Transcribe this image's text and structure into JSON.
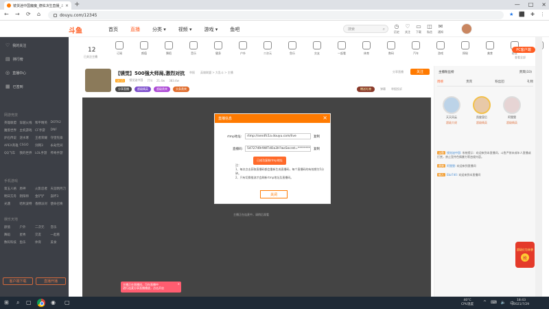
{
  "browser": {
    "tab_title": "镜货迷中国魔魔_德佑决生直播_斗鱼",
    "tab_close": "×",
    "new_tab": "+",
    "url": "douyu.com/12345",
    "window_controls": [
      "—",
      "□",
      "×"
    ],
    "nav": {
      "back": "←",
      "forward": "→",
      "reload": "⟳",
      "home": "⌂"
    },
    "icons": {
      "star": "★",
      "ext1": "⬛",
      "ext2": "✚",
      "menu": "⋮"
    }
  },
  "site": {
    "logo": "斗鱼",
    "nav": [
      "首页",
      "直播",
      "分类 ▾",
      "视频 ▾",
      "游戏 ▾",
      "鱼吧"
    ],
    "search_placeholder": "搜索",
    "search_icon": "⌕",
    "header_icons": [
      {
        "glyph": "◷",
        "label": "历史"
      },
      {
        "glyph": "♡",
        "label": "关注"
      },
      {
        "glyph": "▭",
        "label": "下载"
      },
      {
        "glyph": "◫",
        "label": "私信"
      },
      {
        "glyph": "✉",
        "label": "通知"
      }
    ]
  },
  "sidebar": {
    "items": [
      "我的关注",
      "排行榜",
      "直播中心",
      "已签到"
    ],
    "item_glyphs": [
      "♡",
      "▤",
      "◎",
      "▦"
    ],
    "section_rec": "网游竞技",
    "grid_rec": [
      "英雄联盟",
      "穿越火线",
      "和平精英",
      "DOTA2",
      "魔兽世界",
      "主机游戏",
      "CF手游",
      "DNF",
      "炉石传说",
      "逆水寒",
      "王者荣耀",
      "守望先锋",
      "APEX英雄",
      "CSGO",
      "剑网3",
      "永劫无间",
      "QQ飞车",
      "我的世界",
      "LOL手游",
      "传奇手游"
    ],
    "section_mobile": "手机游戏",
    "grid_mobile": [
      "第五人格",
      "原神",
      "火影忍者",
      "天涯明月刀",
      "明日方舟",
      "阴阳师",
      "金铲铲",
      "崩坏3",
      "光遇",
      "哈利波特",
      "香肠派对",
      "使命召唤"
    ],
    "section_fun": "娱乐天地",
    "grid_fun": [
      "颜值",
      "户外",
      "二次元",
      "音乐",
      "舞蹈",
      "星秀",
      "交友",
      "一起看",
      "数码科技",
      "鱼乐",
      "体育",
      "美食"
    ],
    "bottom_btns": [
      "客户端下载",
      "直播开播"
    ]
  },
  "category_strip": {
    "follow_count": "12",
    "follow_label": "已关注主播",
    "categories": [
      "订阅",
      "颜值",
      "舞蹈",
      "音乐",
      "健身",
      "户外",
      "二次元",
      "鱼乐",
      "交友",
      "一起看",
      "体育",
      "数码",
      "汽车",
      "游戏",
      "探秘",
      "美食",
      "综艺",
      "娱乐"
    ],
    "pc_button": "PC客户端",
    "view_all": "查看全部"
  },
  "room": {
    "title": "【镜觉】500强大师局,激烈对抗",
    "report": "举报",
    "breadcrumb": "英雄联盟 > 大乱斗 > 主播",
    "level": "LV.15",
    "anchor_name": "镜觉迷中国",
    "hot": "774",
    "watch": "21.4w",
    "fans": "383.4w",
    "badges": [
      "分享直播",
      "超级精英",
      "超级贵宾",
      "头条贵宾"
    ],
    "share": "分享直播",
    "follow_btn": "关注",
    "gift_pill": "赠送礼物",
    "actions": [
      "弹幕",
      "举报投诉"
    ]
  },
  "player": {
    "note": "主播正在连麦中，请稍后观看"
  },
  "modal": {
    "title": "直播信息",
    "close": "×",
    "rtmp_label": "rtmp地址:",
    "rtmp_value": "rtmp://sendfc1a.douyu.com/live",
    "code_label": "直播码:",
    "code_value": "5472749r9WTdOa3H?wsSecret=********",
    "copy": "复制",
    "toast": "已成功复制rtmp地址",
    "notes": [
      "注：",
      "1、每次点击获取直播码都会重新生成直播码，每个直播码的有效期为5分钟。",
      "2、只有切换推流才会刷新rtmp地址及直播码。"
    ],
    "ok": "关闭"
  },
  "right_panel": {
    "top_left": "主播粉丝榜",
    "top_right": "贵宾(33)",
    "tabs": [
      "周榜",
      "贵宾",
      "粉丝团",
      "礼物"
    ],
    "ranks": [
      {
        "name": "天天风云",
        "dm": "超级大佬"
      },
      {
        "name": "凯旋皇后",
        "dm": "超级精英"
      },
      {
        "name": "阿狸狸",
        "dm": "超级精英"
      }
    ],
    "chat": [
      {
        "tag": "斗鱼",
        "nick": "镜觉迷中国:",
        "text": "系统提示：欢迎来到本直播间，斗鱼严禁未成年人直播或打赏，禁止宣传色情暴力等违规内容。"
      },
      {
        "tag": "贵宾",
        "nick": "阿狸狸:",
        "text": "欢迎来到直播间"
      },
      {
        "tag": "新人",
        "nick": "Ebz7d0:",
        "text": "欢迎来到本直播间"
      }
    ],
    "redpack_label": "超级红包来袭",
    "redpack_coin": "抢"
  },
  "popup_tip": {
    "line1": "主播正在直播间，可在直播中",
    "line2": "进行连麦分享直播播放，点击开启",
    "close": "×"
  },
  "taskbar": {
    "start": "⊞",
    "search": "⌕",
    "taskview": "▢",
    "app2": "◉",
    "weather_temp": "40°C",
    "weather_label": "CPU温度",
    "tray": [
      "^",
      "⌨",
      "🔈",
      "中"
    ],
    "time": "18:43",
    "date": "2021/7/29"
  }
}
